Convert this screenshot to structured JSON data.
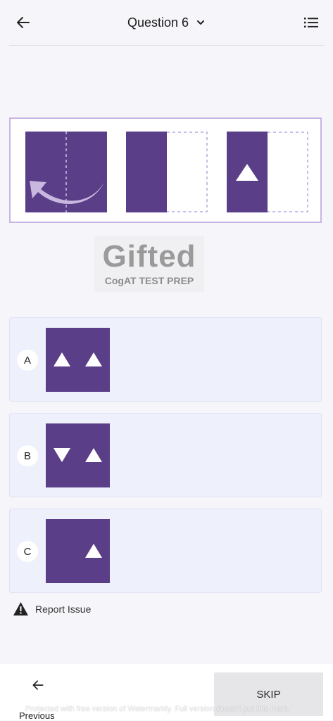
{
  "header": {
    "title": "Question 6",
    "back_icon": "arrow-left-icon",
    "dropdown_icon": "chevron-down-icon",
    "menu_icon": "list-icon"
  },
  "colors": {
    "purple": "#5a3e87",
    "lavender_border": "#c9b4e3",
    "fold_arrow": "#c8b7df",
    "option_bg": "#eef0fb",
    "skip_bg": "#e6e6e9"
  },
  "logo": {
    "word": "Gifted",
    "subtitle": "CogAT TEST PREP"
  },
  "options": [
    {
      "letter": "A"
    },
    {
      "letter": "B"
    },
    {
      "letter": "C"
    }
  ],
  "report": {
    "label": "Report Issue",
    "icon": "warning-icon"
  },
  "footer": {
    "previous_label": "Previous",
    "skip_label": "SKIP",
    "watermark_text": "Protected with free version of Watermarkly. Full version doesn't put this mark."
  }
}
